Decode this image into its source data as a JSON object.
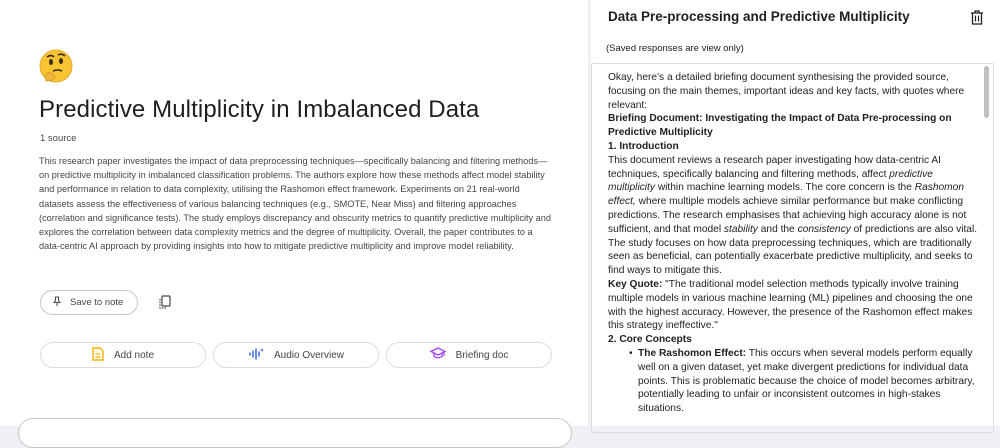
{
  "left": {
    "emoji": "🤔",
    "title": "Predictive Multiplicity in Imbalanced Data",
    "source_count": "1 source",
    "summary": "This research paper investigates the impact of data preprocessing techniques—specifically balancing and filtering methods—on predictive multiplicity in imbalanced classification problems. The authors explore how these methods affect model stability and performance in relation to data complexity, utilising the Rashomon effect framework. Experiments on 21 real-world datasets assess the effectiveness of various balancing techniques (e.g., SMOTE, Near Miss) and filtering approaches (correlation and significance tests). The study employs discrepancy and obscurity metrics to quantify predictive multiplicity and explores the correlation between data complexity metrics and the degree of multiplicity. Overall, the paper contributes to a data-centric AI approach by providing insights into how to mitigate predictive multiplicity and improve model reliability.",
    "save_to_note": "Save to note",
    "actions": {
      "add_note": "Add note",
      "audio_overview": "Audio Overview",
      "briefing_doc": "Briefing doc"
    }
  },
  "right": {
    "title": "Data Pre-processing and Predictive Multiplicity",
    "view_only": "(Saved responses are view only)",
    "intro": "Okay, here's a detailed briefing document synthesising the provided source, focusing on the main themes, important ideas and key facts, with quotes where relevant:",
    "doc_heading": "Briefing Document: Investigating the Impact of Data Pre-processing on Predictive Multiplicity",
    "section1": "1. Introduction",
    "para1_a": "This document reviews a research paper investigating how data-centric AI techniques, specifically balancing and filtering methods, affect ",
    "para1_em1": "predictive multiplicity",
    "para1_b": " within machine learning models. The core concern is the ",
    "para1_em2": "Rashomon effect,",
    "para1_c": " where multiple models achieve similar performance but make conflicting predictions. The research emphasises that achieving high accuracy alone is not sufficient, and that model ",
    "para1_em3": "stability",
    "para1_d": " and the ",
    "para1_em4": "consistency",
    "para1_e": " of predictions are also vital. The study focuses on how data preprocessing techniques, which are traditionally seen as beneficial, can potentially exacerbate predictive multiplicity, and seeks to find ways to mitigate this.",
    "key_quote_label": "Key Quote:",
    "key_quote": " \"The traditional model selection methods typically involve training multiple models in various machine learning (ML) pipelines and choosing the one with the highest accuracy. However, the presence of the Rashomon effect makes this strategy ineffective.\"",
    "section2": "2. Core Concepts",
    "bullet_dot": "•",
    "bullet1_label": "The Rashomon Effect:",
    "bullet1_text": " This occurs when several models perform equally well on a given dataset, yet make divergent predictions for individual data points. This is problematic because the choice of model becomes arbitrary, potentially leading to unfair or inconsistent outcomes in high-stakes situations."
  },
  "colors": {
    "page_bg": "#eef0f3",
    "add_note_icon": "#f4b400",
    "audio_icon": "#4a73e8",
    "briefing_icon": "#a142f4"
  },
  "icons": [
    "pin-icon",
    "copy-icon",
    "note-icon",
    "audio-waveform-icon",
    "graduation-cap-icon",
    "trash-icon"
  ]
}
